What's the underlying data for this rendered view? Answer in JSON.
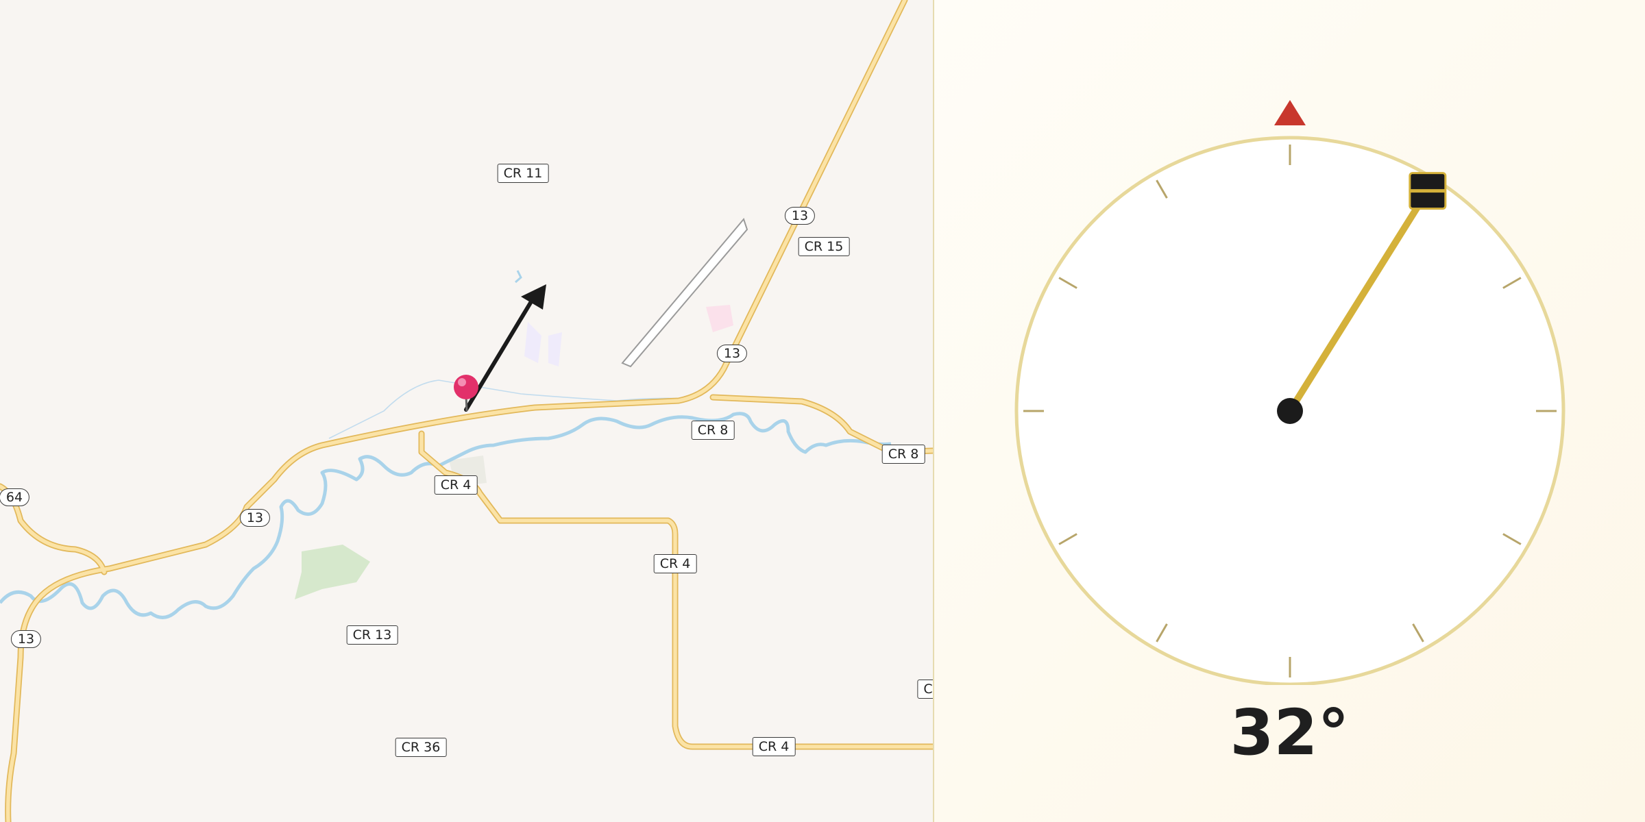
{
  "map": {
    "road_labels": [
      {
        "id": "cr11",
        "text": "CR 11",
        "shape": "box"
      },
      {
        "id": "cr15",
        "text": "CR 15",
        "shape": "box"
      },
      {
        "id": "r13a",
        "text": "13",
        "shape": "oval"
      },
      {
        "id": "r13b",
        "text": "13",
        "shape": "oval"
      },
      {
        "id": "cr8a",
        "text": "CR 8",
        "shape": "box"
      },
      {
        "id": "cr8b",
        "text": "CR 8",
        "shape": "box"
      },
      {
        "id": "cr4a",
        "text": "CR 4",
        "shape": "box"
      },
      {
        "id": "r64",
        "text": "64",
        "shape": "oval"
      },
      {
        "id": "r13c",
        "text": "13",
        "shape": "oval"
      },
      {
        "id": "cr4b",
        "text": "CR 4",
        "shape": "box"
      },
      {
        "id": "r13d",
        "text": "13",
        "shape": "oval"
      },
      {
        "id": "cr13",
        "text": "CR 13",
        "shape": "box"
      },
      {
        "id": "cr36",
        "text": "CR 36",
        "shape": "box"
      },
      {
        "id": "cr4c",
        "text": "CR 4",
        "shape": "box"
      },
      {
        "id": "edge",
        "text": "C",
        "shape": "box"
      }
    ],
    "marker_icon": "map-pin-icon",
    "direction_icon": "direction-arrow-icon",
    "road_color": "#f5d27a",
    "water_color": "#a9d3ea"
  },
  "compass": {
    "heading_deg": 32,
    "heading_text": "32°",
    "north_marker_icon": "north-triangle-icon",
    "needle_color": "#d4b13a",
    "north_color": "#c8372d",
    "ring_color": "#e7d89a"
  }
}
